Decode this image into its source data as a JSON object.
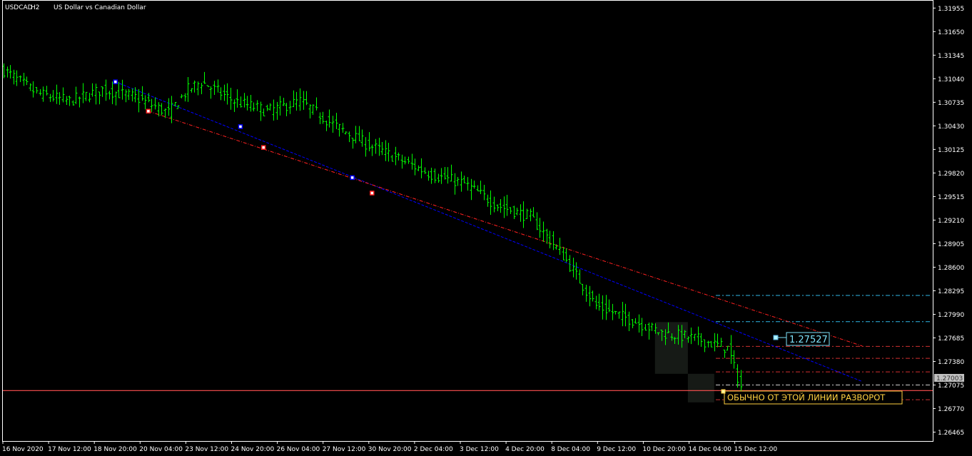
{
  "header": {
    "symbol": "USDCAD",
    "timeframe": "H2",
    "description": "US Dollar vs Canadian Dollar"
  },
  "colors": {
    "background": "#000000",
    "frame": "#ffffff",
    "text": "#ffffff",
    "bars": "#00ff00",
    "blue_trend": "#0000ff",
    "red_trend": "#ff2020",
    "cyan_level": "#2fb8e8",
    "red_level": "#d03030",
    "bid_line": "#ff5050",
    "price_label": "#7de0f8",
    "annotation": "#ffd040"
  },
  "current_price_tag": "1.27003",
  "level_price_label": "1.27527",
  "annotation_text": "ОБЫЧНО ОТ ЭТОЙ ЛИНИИ РАЗВОРОТ",
  "chart_data": {
    "type": "bar",
    "title": "USDCAD, H2:  US Dollar vs Canadian Dollar",
    "price_axis": [
      "1.31955",
      "1.31650",
      "1.31345",
      "1.31040",
      "1.30735",
      "1.30430",
      "1.30125",
      "1.29820",
      "1.29515",
      "1.29210",
      "1.28905",
      "1.28600",
      "1.28295",
      "1.27990",
      "1.27685",
      "1.27380",
      "1.27075",
      "1.26770",
      "1.26465"
    ],
    "ylim": [
      1.2635,
      1.3205
    ],
    "time_axis": [
      "16 Nov 2020",
      "17 Nov 12:00",
      "18 Nov 20:00",
      "20 Nov 04:00",
      "23 Nov 12:00",
      "24 Nov 20:00",
      "26 Nov 04:00",
      "27 Nov 12:00",
      "30 Nov 20:00",
      "2 Dec 04:00",
      "3 Dec 12:00",
      "4 Dec 20:00",
      "8 Dec 04:00",
      "9 Dec 12:00",
      "10 Dec 20:00",
      "14 Dec 04:00",
      "15 Dec 12:00"
    ],
    "bar_count": 225,
    "close_path": [
      [
        0,
        1.3115
      ],
      [
        10,
        1.3085
      ],
      [
        20,
        1.3075
      ],
      [
        30,
        1.309
      ],
      [
        40,
        1.308
      ],
      [
        50,
        1.306
      ],
      [
        56,
        1.309
      ],
      [
        60,
        1.31
      ],
      [
        70,
        1.3075
      ],
      [
        80,
        1.3062
      ],
      [
        90,
        1.3075
      ],
      [
        100,
        1.3045
      ],
      [
        110,
        1.302
      ],
      [
        120,
        1.3
      ],
      [
        130,
        1.298
      ],
      [
        140,
        1.2968
      ],
      [
        150,
        1.294
      ],
      [
        160,
        1.2925
      ],
      [
        170,
        1.2875
      ],
      [
        180,
        1.281
      ],
      [
        190,
        1.2793
      ],
      [
        200,
        1.2775
      ],
      [
        210,
        1.2768
      ],
      [
        220,
        1.2755
      ],
      [
        224,
        1.2705
      ]
    ],
    "series": [
      {
        "points": [
          [
            34,
            1.31
          ],
          [
            72,
            1.3042
          ],
          [
            106,
            1.2976
          ],
          [
            261,
            1.2712
          ]
        ]
      },
      {
        "points": [
          [
            44,
            1.3062
          ],
          [
            79,
            1.3015
          ],
          [
            112,
            1.2956
          ],
          [
            261,
            1.2758
          ]
        ]
      }
    ],
    "horizontal_levels": [
      {
        "price": 1.28235,
        "style": "cyan-dash"
      },
      {
        "price": 1.27895,
        "style": "cyan-dash"
      },
      {
        "price": 1.27575,
        "style": "red-dash"
      },
      {
        "price": 1.2742,
        "style": "red-dash"
      },
      {
        "price": 1.27245,
        "style": "red-dash"
      },
      {
        "price": 1.27075,
        "style": "white-dash"
      },
      {
        "price": 1.26885,
        "style": "red-dash"
      },
      {
        "price": 1.27003,
        "style": "bid-solid"
      }
    ],
    "point_markers": [
      {
        "bar": 34,
        "price": 1.31,
        "color": "blue"
      },
      {
        "bar": 44,
        "price": 1.3062,
        "color": "red"
      },
      {
        "bar": 72,
        "price": 1.3042,
        "color": "blue"
      },
      {
        "bar": 79,
        "price": 1.3015,
        "color": "red"
      },
      {
        "bar": 106,
        "price": 1.2976,
        "color": "blue"
      },
      {
        "bar": 112,
        "price": 1.2956,
        "color": "red"
      }
    ],
    "shaded_zones": [
      {
        "from_bar": 198,
        "to_bar": 208,
        "high": 1.2789,
        "low": 1.2722
      },
      {
        "from_bar": 208,
        "to_bar": 216,
        "high": 1.2722,
        "low": 1.2685
      }
    ]
  }
}
